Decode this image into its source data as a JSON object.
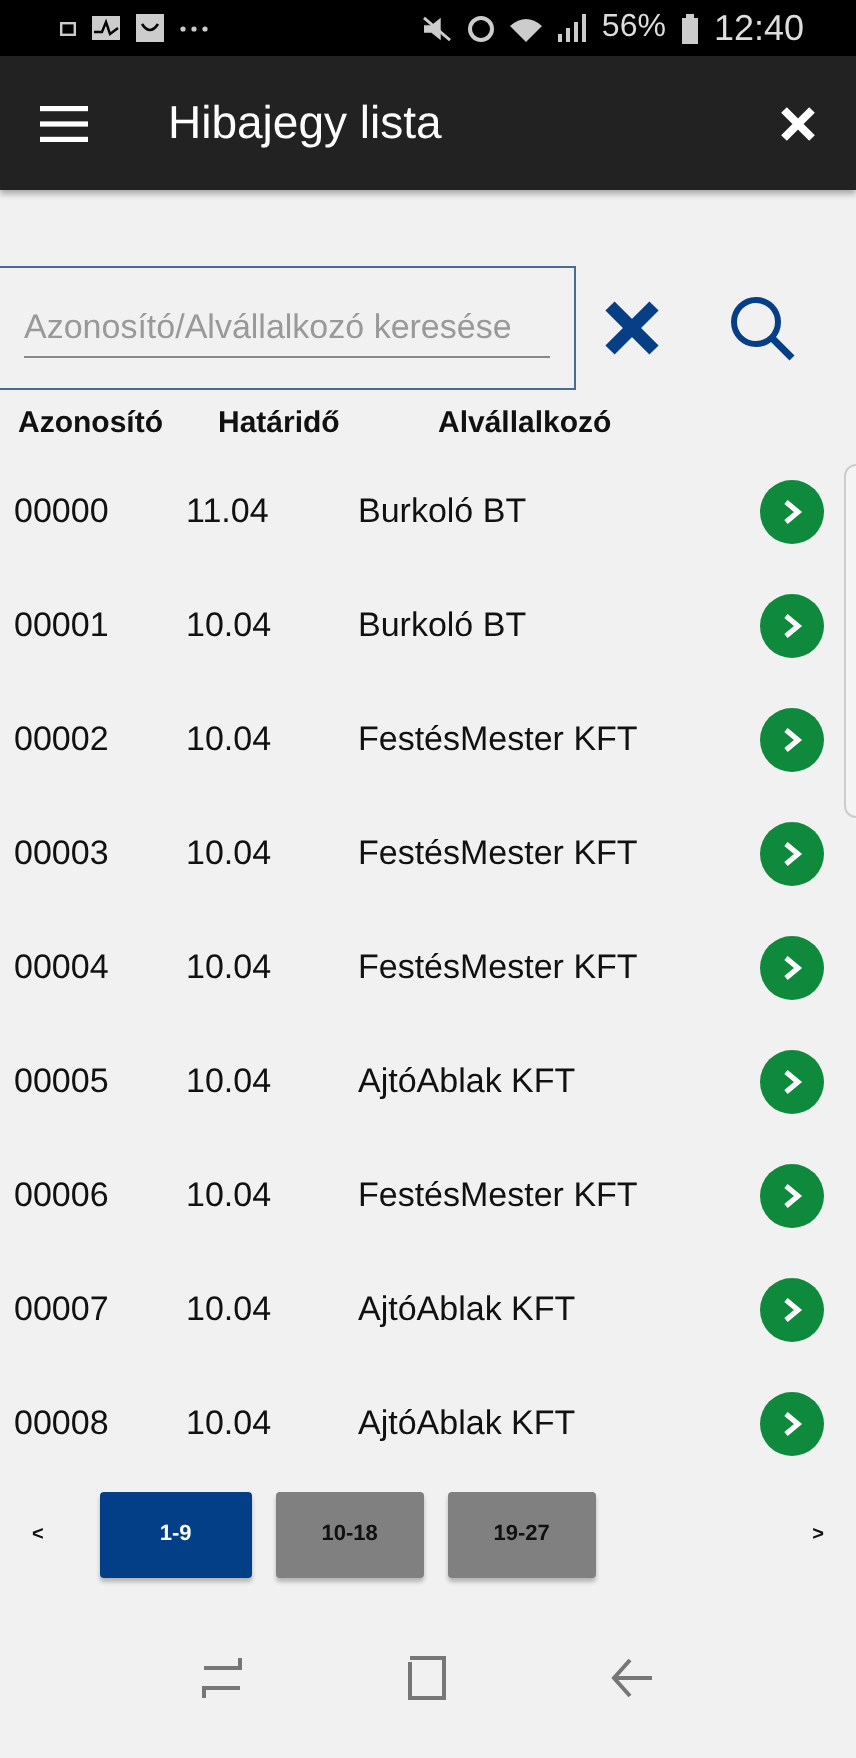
{
  "status_bar": {
    "battery": "56%",
    "time": "12:40"
  },
  "app_bar": {
    "title": "Hibajegy lista"
  },
  "search": {
    "placeholder": "Azonosító/Alvállalkozó keresése"
  },
  "table": {
    "columns": [
      "Azonosító",
      "Határidő",
      "Alvállalkozó"
    ],
    "rows": [
      {
        "id": "00000",
        "deadline": "11.04",
        "contractor": "Burkoló BT"
      },
      {
        "id": "00001",
        "deadline": "10.04",
        "contractor": "Burkoló BT"
      },
      {
        "id": "00002",
        "deadline": "10.04",
        "contractor": "FestésMester KFT"
      },
      {
        "id": "00003",
        "deadline": "10.04",
        "contractor": "FestésMester KFT"
      },
      {
        "id": "00004",
        "deadline": "10.04",
        "contractor": "FestésMester KFT"
      },
      {
        "id": "00005",
        "deadline": "10.04",
        "contractor": "AjtóAblak KFT"
      },
      {
        "id": "00006",
        "deadline": "10.04",
        "contractor": "FestésMester KFT"
      },
      {
        "id": "00007",
        "deadline": "10.04",
        "contractor": "AjtóAblak KFT"
      },
      {
        "id": "00008",
        "deadline": "10.04",
        "contractor": "AjtóAblak KFT"
      }
    ]
  },
  "pagination": {
    "prev": "<",
    "next": ">",
    "pages": [
      {
        "label": "1-9",
        "selected": true
      },
      {
        "label": "10-18",
        "selected": false
      },
      {
        "label": "19-27",
        "selected": false
      }
    ]
  }
}
